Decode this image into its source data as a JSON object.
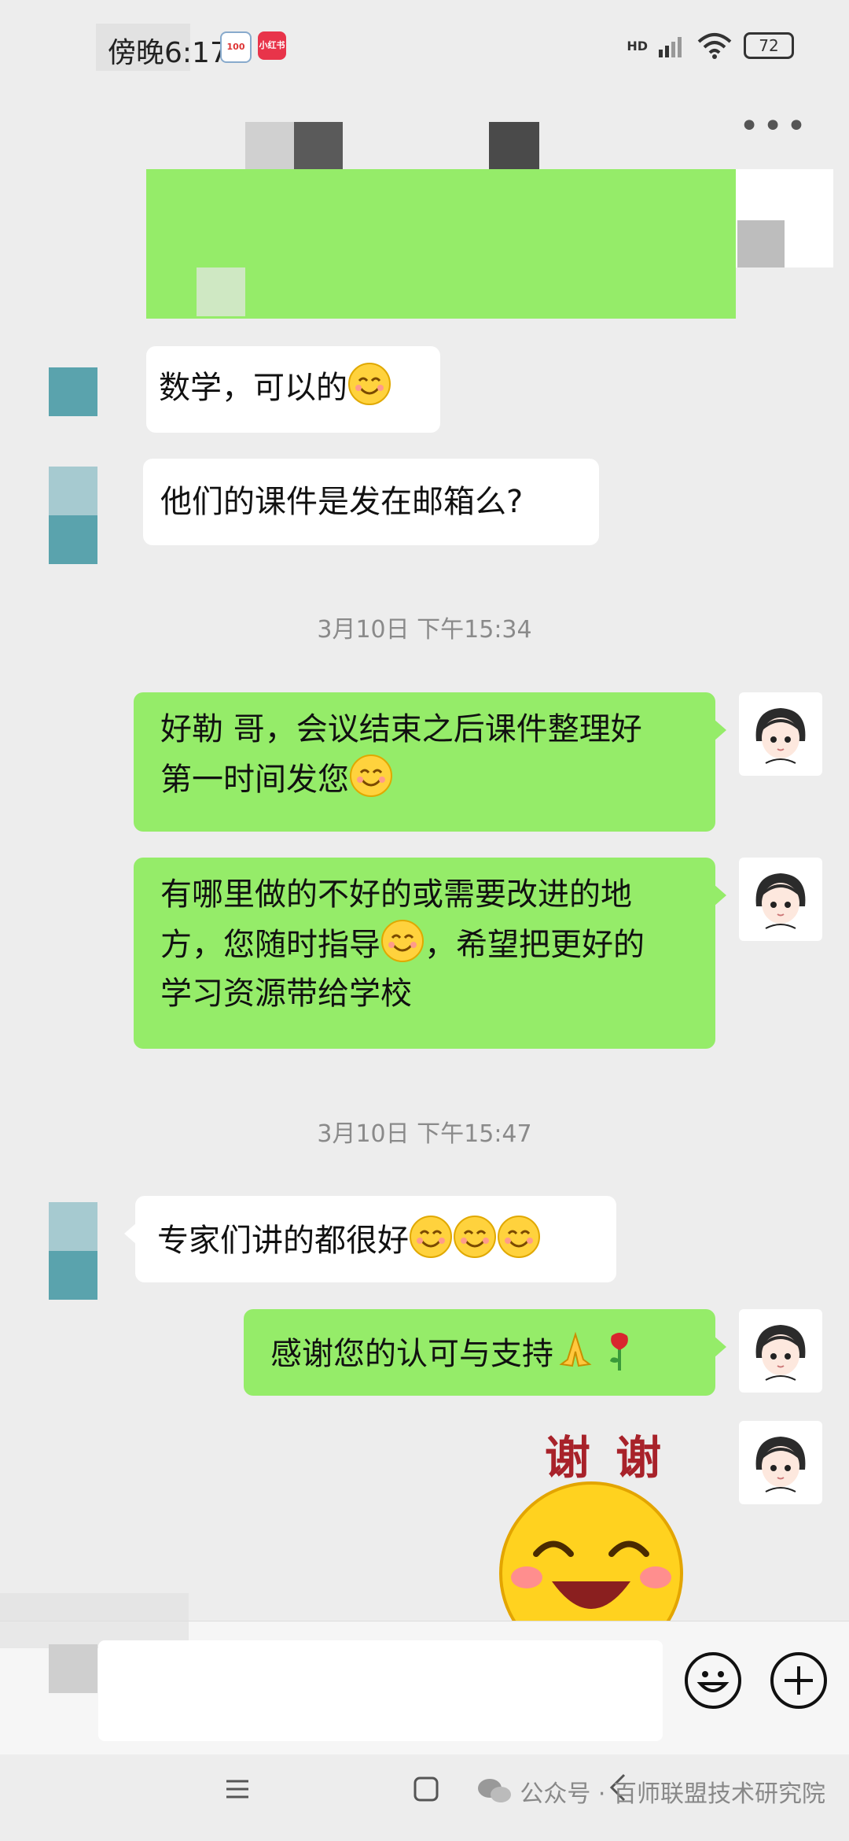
{
  "status_bar": {
    "time": "傍晚6:17",
    "badge_1": "100",
    "badge_2": "小红书",
    "network": "HD",
    "battery": "72"
  },
  "messages": {
    "m1": "数学，可以的",
    "m2": "他们的课件是发在邮箱么?",
    "ts1": "3月10日 下午15:34",
    "m3_line1": "好勒 哥，会议结束之后课件整理好",
    "m3_line2": "第一时间发您",
    "m4_line1": "有哪里做的不好的或需要改进的地",
    "m4_line2a": "方，您随时指导",
    "m4_line2b": "，希望把更好的",
    "m4_line3": "学习资源带给学校",
    "ts2": "3月10日 下午15:47",
    "m5": "专家们讲的都很好",
    "m6": "感谢您的认可与支持",
    "sticker_text": "谢 谢"
  },
  "watermark": "公众号 · 百师联盟技术研究院",
  "colors": {
    "green_bubble": "#95ec69",
    "background": "#ededed",
    "other_avatar": "#5aa3ad"
  },
  "icons": [
    "more-icon",
    "emoji-button-icon",
    "plus-button-icon",
    "menu-nav-icon",
    "home-nav-icon",
    "back-nav-icon",
    "wechat-icon"
  ]
}
